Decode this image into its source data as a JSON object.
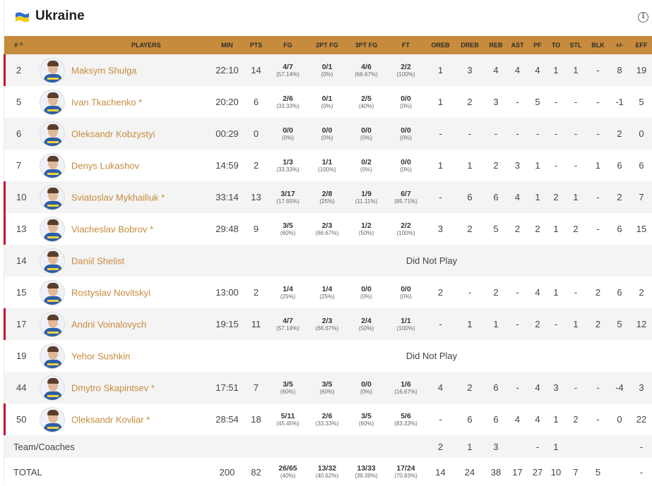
{
  "team": {
    "name": "Ukraine",
    "flag_colors": [
      "#2e6fd1",
      "#f5cc1a"
    ]
  },
  "columns": [
    "#",
    "PLAYERS",
    "MIN",
    "PTS",
    "FG",
    "2PT FG",
    "3PT FG",
    "FT",
    "OREB",
    "DREB",
    "REB",
    "AST",
    "PF",
    "TO",
    "STL",
    "BLK",
    "+/-",
    "EFF"
  ],
  "sort_indicator": "^",
  "dnp_text": "Did Not Play",
  "players": [
    {
      "num": "2",
      "name": "Maksym Shulga",
      "starter": true,
      "dnp": false,
      "min": "22:10",
      "pts": "14",
      "fg": "4/7",
      "fg_pct": "(57.14%)",
      "fg2": "0/1",
      "fg2_pct": "(0%)",
      "fg3": "4/6",
      "fg3_pct": "(66.67%)",
      "ft": "2/2",
      "ft_pct": "(100%)",
      "oreb": "1",
      "dreb": "3",
      "reb": "4",
      "ast": "4",
      "pf": "4",
      "to": "1",
      "stl": "1",
      "blk": "-",
      "pm": "8",
      "eff": "19"
    },
    {
      "num": "5",
      "name": "Ivan Tkachenko *",
      "starter": false,
      "dnp": false,
      "min": "20:20",
      "pts": "6",
      "fg": "2/6",
      "fg_pct": "(33.33%)",
      "fg2": "0/1",
      "fg2_pct": "(0%)",
      "fg3": "2/5",
      "fg3_pct": "(40%)",
      "ft": "0/0",
      "ft_pct": "(0%)",
      "oreb": "1",
      "dreb": "2",
      "reb": "3",
      "ast": "-",
      "pf": "5",
      "to": "-",
      "stl": "-",
      "blk": "-",
      "pm": "-1",
      "eff": "5"
    },
    {
      "num": "6",
      "name": "Oleksandr Kobzystyi",
      "starter": false,
      "dnp": false,
      "min": "00:29",
      "pts": "0",
      "fg": "0/0",
      "fg_pct": "(0%)",
      "fg2": "0/0",
      "fg2_pct": "(0%)",
      "fg3": "0/0",
      "fg3_pct": "(0%)",
      "ft": "0/0",
      "ft_pct": "(0%)",
      "oreb": "-",
      "dreb": "-",
      "reb": "-",
      "ast": "-",
      "pf": "-",
      "to": "-",
      "stl": "-",
      "blk": "-",
      "pm": "2",
      "eff": "0"
    },
    {
      "num": "7",
      "name": "Denys Lukashov",
      "starter": false,
      "dnp": false,
      "min": "14:59",
      "pts": "2",
      "fg": "1/3",
      "fg_pct": "(33.33%)",
      "fg2": "1/1",
      "fg2_pct": "(100%)",
      "fg3": "0/2",
      "fg3_pct": "(0%)",
      "ft": "0/0",
      "ft_pct": "(0%)",
      "oreb": "1",
      "dreb": "1",
      "reb": "2",
      "ast": "3",
      "pf": "1",
      "to": "-",
      "stl": "-",
      "blk": "1",
      "pm": "6",
      "eff": "6"
    },
    {
      "num": "10",
      "name": "Sviatoslav Mykhailiuk *",
      "starter": true,
      "dnp": false,
      "min": "33:14",
      "pts": "13",
      "fg": "3/17",
      "fg_pct": "(17.65%)",
      "fg2": "2/8",
      "fg2_pct": "(25%)",
      "fg3": "1/9",
      "fg3_pct": "(11.11%)",
      "ft": "6/7",
      "ft_pct": "(85.71%)",
      "oreb": "-",
      "dreb": "6",
      "reb": "6",
      "ast": "4",
      "pf": "1",
      "to": "2",
      "stl": "1",
      "blk": "-",
      "pm": "2",
      "eff": "7"
    },
    {
      "num": "13",
      "name": "Viacheslav Bobrov *",
      "starter": true,
      "dnp": false,
      "min": "29:48",
      "pts": "9",
      "fg": "3/5",
      "fg_pct": "(60%)",
      "fg2": "2/3",
      "fg2_pct": "(66.67%)",
      "fg3": "1/2",
      "fg3_pct": "(50%)",
      "ft": "2/2",
      "ft_pct": "(100%)",
      "oreb": "3",
      "dreb": "2",
      "reb": "5",
      "ast": "2",
      "pf": "2",
      "to": "1",
      "stl": "2",
      "blk": "-",
      "pm": "6",
      "eff": "15"
    },
    {
      "num": "14",
      "name": "Daniil Shelist",
      "starter": false,
      "dnp": true
    },
    {
      "num": "15",
      "name": "Rostyslav Novitskyi",
      "starter": false,
      "dnp": false,
      "min": "13:00",
      "pts": "2",
      "fg": "1/4",
      "fg_pct": "(25%)",
      "fg2": "1/4",
      "fg2_pct": "(25%)",
      "fg3": "0/0",
      "fg3_pct": "(0%)",
      "ft": "0/0",
      "ft_pct": "(0%)",
      "oreb": "2",
      "dreb": "-",
      "reb": "2",
      "ast": "-",
      "pf": "4",
      "to": "1",
      "stl": "-",
      "blk": "2",
      "pm": "6",
      "eff": "2"
    },
    {
      "num": "17",
      "name": "Andrii Voinalovych",
      "starter": true,
      "dnp": false,
      "min": "19:15",
      "pts": "11",
      "fg": "4/7",
      "fg_pct": "(57.14%)",
      "fg2": "2/3",
      "fg2_pct": "(66.67%)",
      "fg3": "2/4",
      "fg3_pct": "(50%)",
      "ft": "1/1",
      "ft_pct": "(100%)",
      "oreb": "-",
      "dreb": "1",
      "reb": "1",
      "ast": "-",
      "pf": "2",
      "to": "-",
      "stl": "1",
      "blk": "2",
      "pm": "5",
      "eff": "12"
    },
    {
      "num": "19",
      "name": "Yehor Sushkin",
      "starter": false,
      "dnp": true
    },
    {
      "num": "44",
      "name": "Dmytro Skapintsev *",
      "starter": false,
      "dnp": false,
      "min": "17:51",
      "pts": "7",
      "fg": "3/5",
      "fg_pct": "(60%)",
      "fg2": "3/5",
      "fg2_pct": "(60%)",
      "fg3": "0/0",
      "fg3_pct": "(0%)",
      "ft": "1/6",
      "ft_pct": "(16.67%)",
      "oreb": "4",
      "dreb": "2",
      "reb": "6",
      "ast": "-",
      "pf": "4",
      "to": "3",
      "stl": "-",
      "blk": "-",
      "pm": "-4",
      "eff": "3"
    },
    {
      "num": "50",
      "name": "Oleksandr Kovliar *",
      "starter": true,
      "dnp": false,
      "min": "28:54",
      "pts": "18",
      "fg": "5/11",
      "fg_pct": "(45.45%)",
      "fg2": "2/6",
      "fg2_pct": "(33.33%)",
      "fg3": "3/5",
      "fg3_pct": "(60%)",
      "ft": "5/6",
      "ft_pct": "(83.33%)",
      "oreb": "-",
      "dreb": "6",
      "reb": "6",
      "ast": "4",
      "pf": "4",
      "to": "1",
      "stl": "2",
      "blk": "-",
      "pm": "0",
      "eff": "22"
    }
  ],
  "team_coaches": {
    "label": "Team/Coaches",
    "oreb": "2",
    "dreb": "1",
    "reb": "3",
    "ast": "",
    "pf": "-",
    "to": "1",
    "stl": "",
    "blk": "",
    "pm": "",
    "eff": "-"
  },
  "total": {
    "label": "TOTAL",
    "min": "200",
    "pts": "82",
    "fg": "26/65",
    "fg_pct": "(40%)",
    "fg2": "13/32",
    "fg2_pct": "(40.62%)",
    "fg3": "13/33",
    "fg3_pct": "(39.39%)",
    "ft": "17/24",
    "ft_pct": "(70.83%)",
    "oreb": "14",
    "dreb": "24",
    "reb": "38",
    "ast": "17",
    "pf": "27",
    "to": "10",
    "stl": "7",
    "blk": "5",
    "pm": "",
    "eff": "-"
  }
}
